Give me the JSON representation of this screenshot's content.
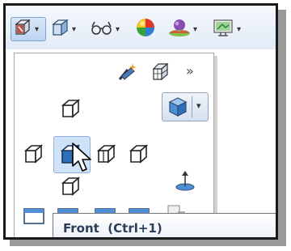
{
  "toolbar": {
    "items": [
      {
        "name": "view-orientation",
        "icon": "view-orientation-icon",
        "active": true,
        "has_dropdown": true
      },
      {
        "name": "display-style",
        "icon": "display-style-icon",
        "has_dropdown": true
      },
      {
        "name": "hide-show-items",
        "icon": "hide-show-icon",
        "has_dropdown": true
      },
      {
        "name": "edit-appearance",
        "icon": "appearance-sphere-icon",
        "has_dropdown": false
      },
      {
        "name": "apply-scene",
        "icon": "scene-icon",
        "has_dropdown": true
      },
      {
        "name": "view-settings",
        "icon": "view-settings-icon",
        "has_dropdown": true
      }
    ]
  },
  "panel": {
    "top_icons": [
      "new-view-icon",
      "view-selector-icon",
      "more-chevron-icon"
    ],
    "more_glyph": "»",
    "views": [
      "top-view",
      "left-view",
      "front-view",
      "right-view",
      "back-view",
      "bottom-view",
      "isometric-view",
      "normal-to-view"
    ],
    "selected_view": "front-view"
  },
  "tooltip": {
    "text": "Front  (Ctrl+1)"
  },
  "colors": {
    "toolbar_bg": "#e3ebf6",
    "selected_bg": "#cfe2f8",
    "tooltip_text": "#2b3e5a",
    "cube_face": "#5b9bd5"
  }
}
